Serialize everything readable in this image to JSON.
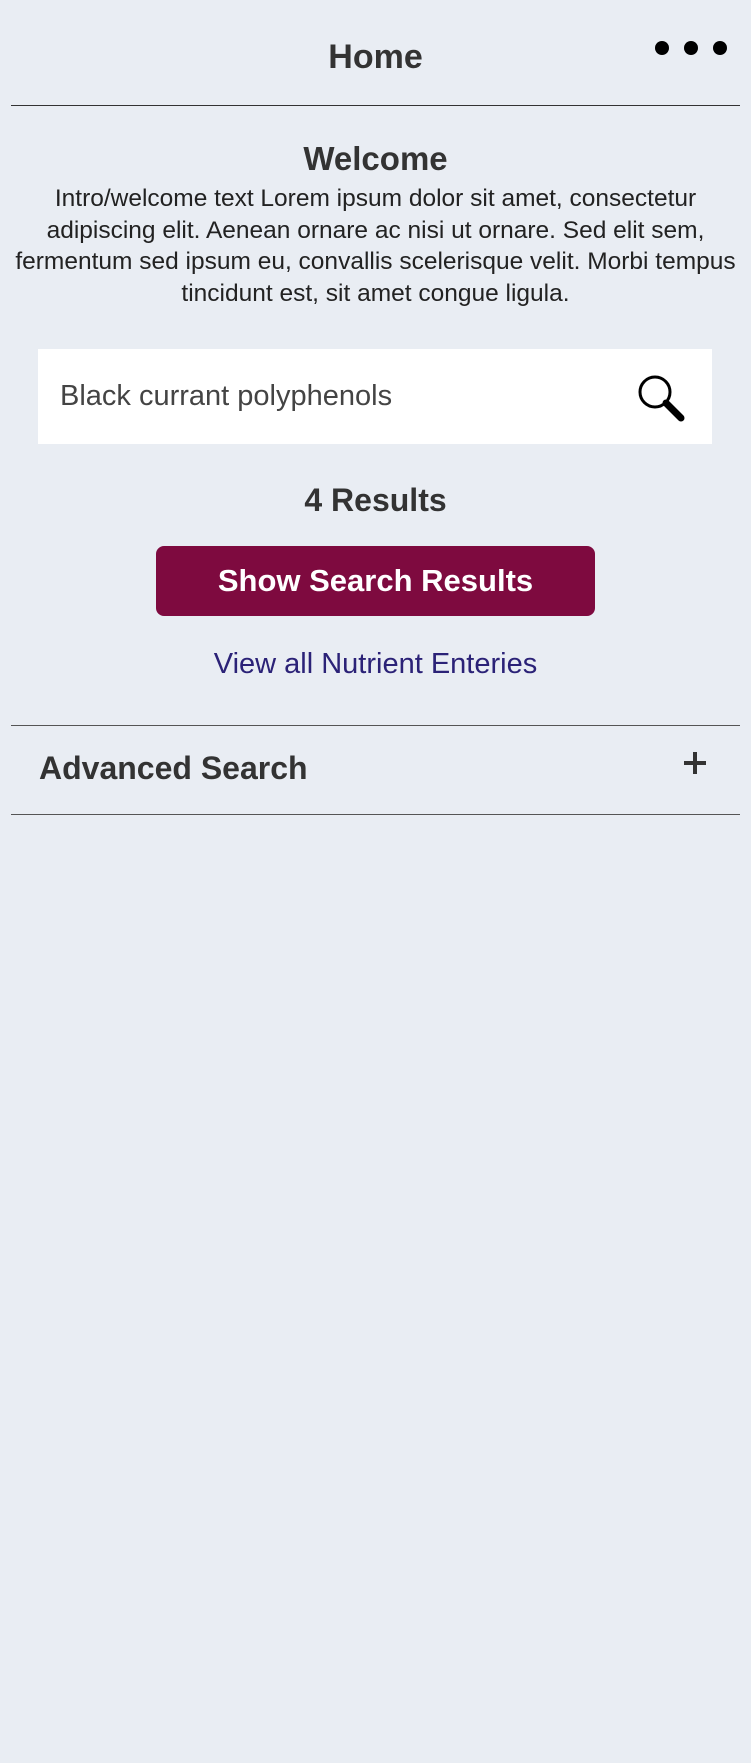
{
  "header": {
    "title": "Home",
    "more_icon": "more-horizontal-icon"
  },
  "welcome": {
    "title": "Welcome",
    "intro": "Intro/welcome text Lorem ipsum dolor sit amet, consectetur adipiscing elit. Aenean ornare ac nisi ut ornare. Sed elit sem, fermentum sed ipsum eu, convallis scelerisque velit. Morbi tempus tincidunt est, sit amet congue ligula."
  },
  "search": {
    "value": "Black currant polyphenols",
    "placeholder": "",
    "icon": "search-icon"
  },
  "results": {
    "count_label": "4 Results",
    "show_button_label": "Show Search Results",
    "view_all_label": "View all Nutrient Enteries"
  },
  "advanced_search": {
    "label": "Advanced Search",
    "icon": "plus-icon"
  },
  "colors": {
    "background": "#e9edf3",
    "primary_button": "#7e0a3f",
    "link": "#2b2277",
    "text": "#333333"
  }
}
